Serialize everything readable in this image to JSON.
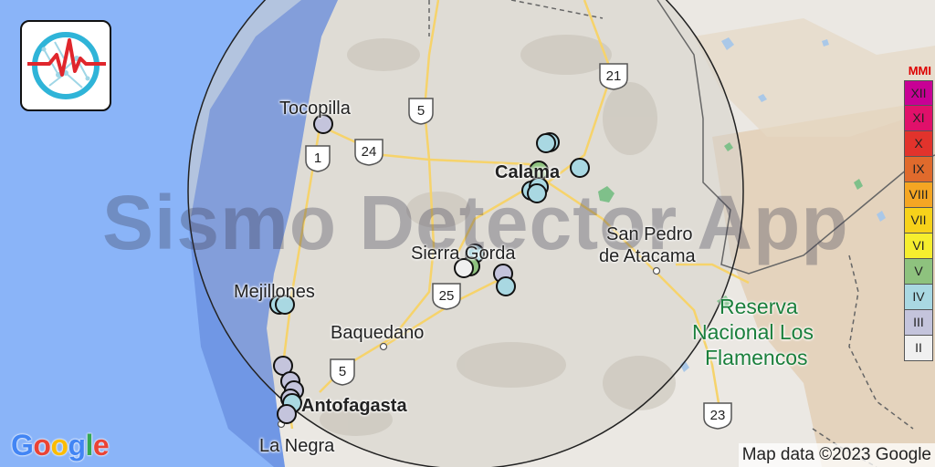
{
  "watermark": "Sismo Detector App",
  "places": {
    "tocopilla": "Tocopilla",
    "calama": "Calama",
    "san_pedro_1": "San Pedro",
    "san_pedro_2": "de Atacama",
    "sierra_gorda": "Sierra Gorda",
    "mejillones": "Mejillones",
    "baquedano": "Baquedano",
    "antofagasta": "Antofagasta",
    "la_negra": "La Negra",
    "reserva_1": "Reserva",
    "reserva_2": "Nacional Los",
    "reserva_3": "Flamencos"
  },
  "highway_shields": [
    "1",
    "24",
    "5",
    "21",
    "25",
    "5",
    "23"
  ],
  "google_logo": [
    "G",
    "o",
    "o",
    "g",
    "l",
    "e"
  ],
  "google_colors": [
    "#4285F4",
    "#EA4335",
    "#FBBC05",
    "#4285F4",
    "#34A853",
    "#EA4335"
  ],
  "attribution": "Map data ©2023 Google",
  "app_icon": "seismograph-globe-icon",
  "mmi_legend": {
    "title": "MMI",
    "levels": [
      {
        "label": "XII",
        "color": "#c80095"
      },
      {
        "label": "XI",
        "color": "#e0106a"
      },
      {
        "label": "X",
        "color": "#e2332c"
      },
      {
        "label": "IX",
        "color": "#e06a2c"
      },
      {
        "label": "VIII",
        "color": "#f5a623"
      },
      {
        "label": "VII",
        "color": "#f7d21a"
      },
      {
        "label": "VI",
        "color": "#f6ee2e"
      },
      {
        "label": "V",
        "color": "#8ec27e"
      },
      {
        "label": "IV",
        "color": "#a9d8e2"
      },
      {
        "label": "III",
        "color": "#c4c4dc"
      },
      {
        "label": "II",
        "color": "#f0f0f0"
      }
    ]
  }
}
